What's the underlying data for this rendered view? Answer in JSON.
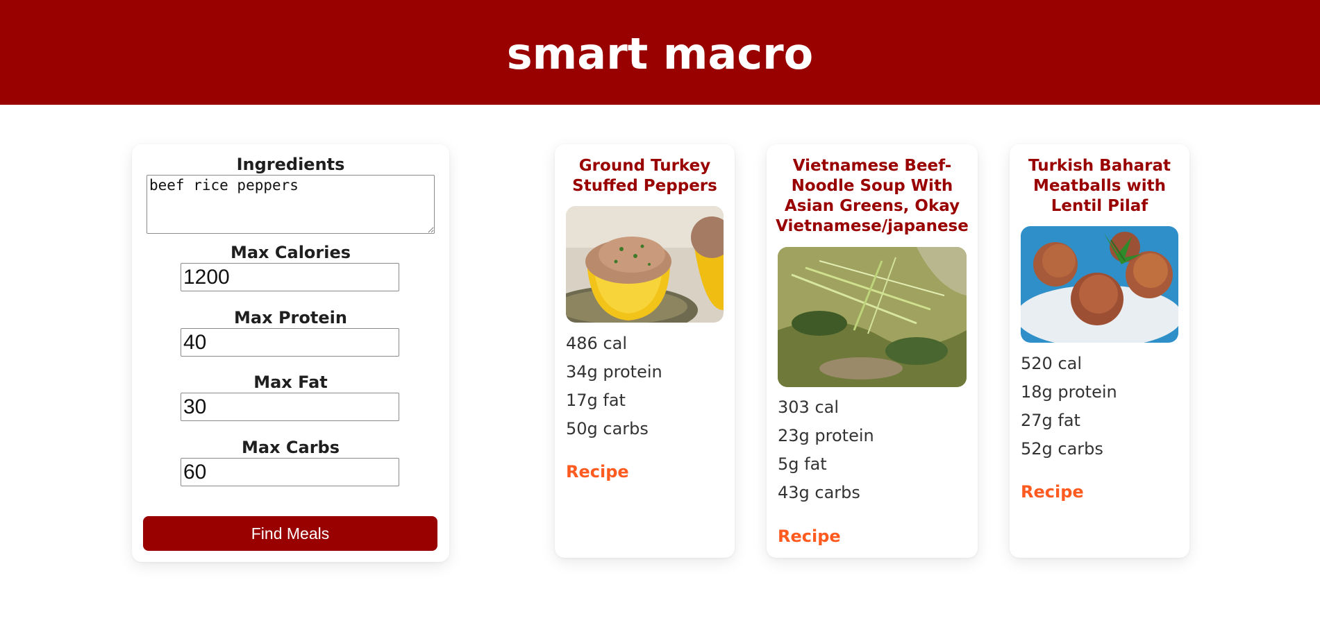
{
  "app": {
    "title": "smart macro"
  },
  "form": {
    "ingredients_label": "Ingredients",
    "ingredients_value": "beef rice peppers",
    "max_calories_label": "Max Calories",
    "max_calories_value": "1200",
    "max_protein_label": "Max Protein",
    "max_protein_value": "40",
    "max_fat_label": "Max Fat",
    "max_fat_value": "30",
    "max_carbs_label": "Max Carbs",
    "max_carbs_value": "60",
    "submit_label": "Find Meals"
  },
  "meals": [
    {
      "title": "Ground Turkey Stuffed Peppers",
      "image": "stuffed-peppers-photo",
      "calories": "486 cal",
      "protein": "34g protein",
      "fat": "17g fat",
      "carbs": "50g carbs",
      "recipe_label": "Recipe"
    },
    {
      "title": "Vietnamese Beef-Noodle Soup With Asian Greens, Okay Vietnamese/japanese",
      "image": "noodle-soup-photo",
      "calories": "303 cal",
      "protein": "23g protein",
      "fat": "5g fat",
      "carbs": "43g carbs",
      "recipe_label": "Recipe"
    },
    {
      "title": "Turkish Baharat Meatballs with Lentil Pilaf",
      "image": "meatballs-photo",
      "calories": "520 cal",
      "protein": "18g protein",
      "fat": "27g fat",
      "carbs": "52g carbs",
      "recipe_label": "Recipe"
    }
  ],
  "colors": {
    "brand": "#990000",
    "link": "#ff5a1f",
    "text": "#333333"
  }
}
